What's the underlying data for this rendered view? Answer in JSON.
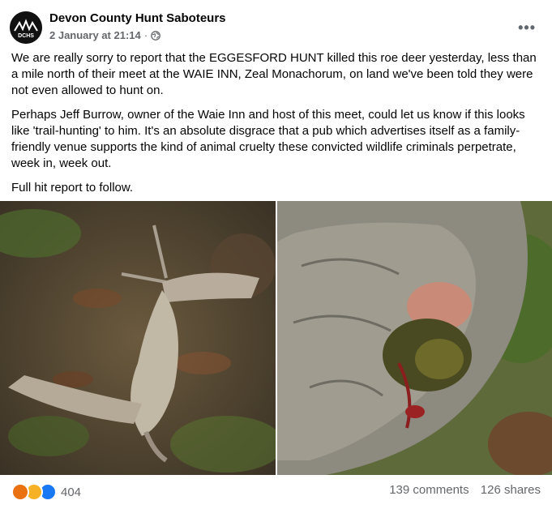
{
  "post": {
    "author": "Devon County Hunt Saboteurs",
    "avatar_text": "DCHS",
    "timestamp": "2 January at 21:14",
    "separator": "·",
    "more_label": "•••",
    "paragraphs": [
      "We are really sorry to report that the EGGESFORD HUNT killed this roe deer yesterday, less than a mile north of their meet at the WAIE INN, Zeal Monachorum, on land we've been told they were not even allowed to hunt on.",
      "Perhaps Jeff Burrow, owner of the Waie Inn and host of this meet, could let us know if this looks like 'trail-hunting' to him. It's an absolute disgrace that a pub which advertises itself as a family-friendly venue supports the kind of animal cruelty these convicted wildlife criminals perpetrate, week in, week out.",
      "Full hit report to follow."
    ]
  },
  "footer": {
    "reaction_count": "404",
    "reactions": [
      "angry-icon",
      "sad-icon",
      "like-icon"
    ],
    "comments": "139 comments",
    "shares": "126 shares"
  },
  "colors": {
    "link_grey": "#65676b",
    "like_blue": "#1877f2",
    "angry_orange": "#e9710f",
    "sad_yellow": "#f7b125"
  }
}
